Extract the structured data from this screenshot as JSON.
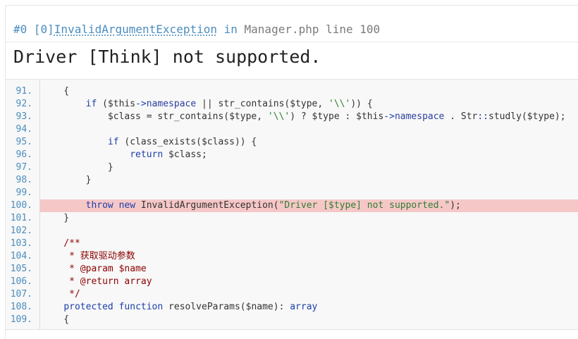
{
  "trace": {
    "prefix": "#0 [0]",
    "exception": "InvalidArgumentException",
    "in": "in",
    "file": "Manager.php line 100"
  },
  "title": "Driver [Think] not supported.",
  "code": {
    "highlight_line": "100.",
    "lines": [
      {
        "num": "91.",
        "text": "    {"
      },
      {
        "num": "92.",
        "text": "        if ($this->namespace || str_contains($type, '\\\\')) {"
      },
      {
        "num": "93.",
        "text": "            $class = str_contains($type, '\\\\') ? $type : $this->namespace . Str::studly($type);"
      },
      {
        "num": "94.",
        "text": ""
      },
      {
        "num": "95.",
        "text": "            if (class_exists($class)) {"
      },
      {
        "num": "96.",
        "text": "                return $class;"
      },
      {
        "num": "97.",
        "text": "            }"
      },
      {
        "num": "98.",
        "text": "        }"
      },
      {
        "num": "99.",
        "text": ""
      },
      {
        "num": "100.",
        "text": "        throw new InvalidArgumentException(\"Driver [$type] not supported.\");"
      },
      {
        "num": "101.",
        "text": "    }"
      },
      {
        "num": "102.",
        "text": ""
      },
      {
        "num": "103.",
        "text": "    /**"
      },
      {
        "num": "104.",
        "text": "     * 获取驱动参数"
      },
      {
        "num": "105.",
        "text": "     * @param $name"
      },
      {
        "num": "106.",
        "text": "     * @return array"
      },
      {
        "num": "107.",
        "text": "     */"
      },
      {
        "num": "108.",
        "text": "    protected function resolveParams($name): array"
      },
      {
        "num": "109.",
        "text": "    {"
      }
    ]
  }
}
